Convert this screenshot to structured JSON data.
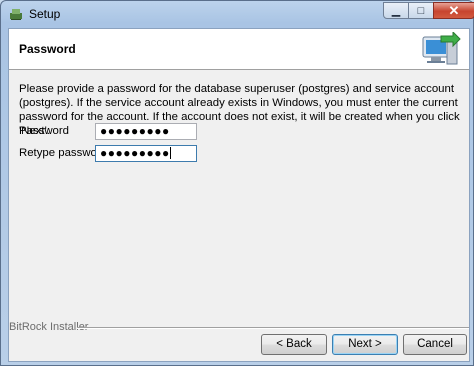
{
  "window": {
    "title": "Setup"
  },
  "header": {
    "title": "Password"
  },
  "description": "Please provide a password for the database superuser (postgres) and service account (postgres). If the service account already exists in Windows, you must enter the current password for the account. If the account does not exist, it will be created when you click 'Next'.",
  "form": {
    "password_label": "Password",
    "password_value": "●●●●●●●●●",
    "retype_label": "Retype password",
    "retype_value": "●●●●●●●●●"
  },
  "footer": {
    "installer_label": "BitRock Installer",
    "back_label": "< Back",
    "next_label": "Next >",
    "cancel_label": "Cancel"
  },
  "colors": {
    "close_button": "#c7442f",
    "title_bar": "#a9c4e4"
  }
}
